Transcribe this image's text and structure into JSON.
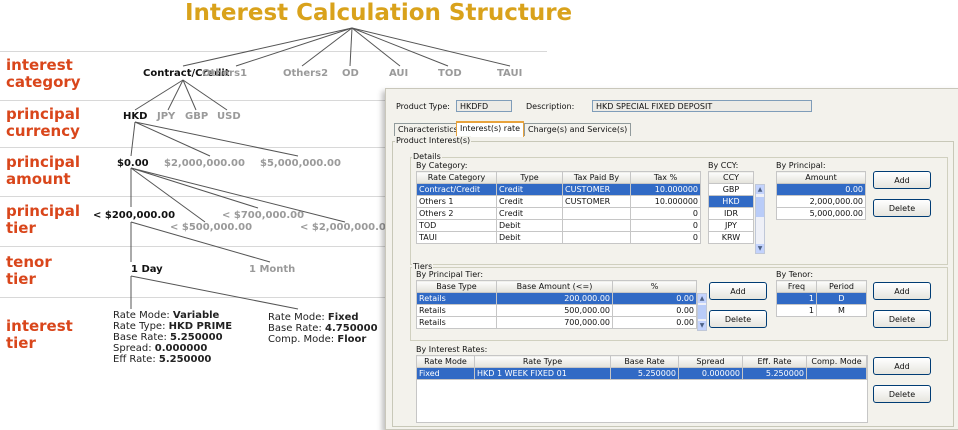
{
  "diagram": {
    "title": "Interest Calculation Structure",
    "levels": {
      "category": "interest category",
      "currency": "principal currency",
      "amount": "principal amount",
      "tier": "principal tier",
      "tenor": "tenor tier",
      "interest": "interest tier"
    },
    "category_nodes": [
      "Contract/Credit",
      "Others1",
      "Others2",
      "OD",
      "AUI",
      "TOD",
      "TAUI"
    ],
    "currency_nodes": [
      "HKD",
      "JPY",
      "GBP",
      "USD"
    ],
    "amount_nodes": [
      "$0.00",
      "$2,000,000.00",
      "$5,000,000.00"
    ],
    "tier_nodes": [
      "< $200,000.00",
      "< $500,000.00",
      "< $700,000.00",
      "< $2,000,000.00"
    ],
    "tenor_nodes": [
      "1 Day",
      "1 Month"
    ],
    "variable": {
      "rate_mode_label": "Rate Mode:",
      "rate_mode": "Variable",
      "rate_type_label": "Rate Type:",
      "rate_type": "HKD PRIME",
      "base_rate_label": "Base Rate:",
      "base_rate": "5.250000",
      "spread_label": "Spread:",
      "spread": "0.000000",
      "eff_rate_label": "Eff Rate:",
      "eff_rate": "5.250000"
    },
    "fixed": {
      "rate_mode_label": "Rate Mode:",
      "rate_mode": "Fixed",
      "base_rate_label": "Base Rate:",
      "base_rate": "4.750000",
      "comp_mode_label": "Comp. Mode:",
      "comp_mode": "Floor"
    }
  },
  "window": {
    "product_type_label": "Product Type:",
    "product_type": "HKDFD",
    "description_label": "Description:",
    "description": "HKD SPECIAL FIXED DEPOSIT",
    "tabs": [
      "Characteristics",
      "Interest(s) rate",
      "Charge(s) and Service(s)"
    ],
    "product_interest_title": "Product Interest(s)",
    "details_title": "Details",
    "by_category_title": "By Category:",
    "category_columns": [
      "Rate Category",
      "Type",
      "Tax Paid By",
      "Tax %"
    ],
    "category_rows": [
      [
        "Contract/Credit",
        "Credit",
        "CUSTOMER",
        "10.000000"
      ],
      [
        "Others 1",
        "Credit",
        "CUSTOMER",
        "10.000000"
      ],
      [
        "Others 2",
        "Credit",
        "",
        "0"
      ],
      [
        "TOD",
        "Debit",
        "",
        "0"
      ],
      [
        "TAUI",
        "Debit",
        "",
        "0"
      ]
    ],
    "by_ccy_title": "By CCY:",
    "ccy_column": "CCY",
    "ccy_rows": [
      "GBP",
      "HKD",
      "IDR",
      "JPY",
      "KRW"
    ],
    "by_principal_title": "By Principal:",
    "principal_column": "Amount",
    "principal_rows": [
      "0.00",
      "2,000,000.00",
      "5,000,000.00"
    ],
    "tiers_title": "Tiers",
    "by_principal_tier_title": "By Principal Tier:",
    "tier_columns": [
      "Base Type",
      "Base Amount (<=)",
      "%"
    ],
    "tier_rows": [
      [
        "Retails",
        "200,000.00",
        "0.00"
      ],
      [
        "Retails",
        "500,000.00",
        "0.00"
      ],
      [
        "Retails",
        "700,000.00",
        "0.00"
      ]
    ],
    "by_tenor_title": "By Tenor:",
    "tenor_columns": [
      "Freq",
      "Period"
    ],
    "tenor_rows": [
      [
        "1",
        "D"
      ],
      [
        "1",
        "M"
      ]
    ],
    "by_interest_rates_title": "By Interest Rates:",
    "rate_columns": [
      "Rate Mode",
      "Rate Type",
      "Base Rate",
      "Spread",
      "Eff. Rate",
      "Comp. Mode"
    ],
    "rate_rows": [
      [
        "Fixed",
        "HKD 1 WEEK FIXED 01",
        "5.250000",
        "0.000000",
        "5.250000",
        ""
      ]
    ],
    "add_label": "Add",
    "delete_label": "Delete"
  }
}
